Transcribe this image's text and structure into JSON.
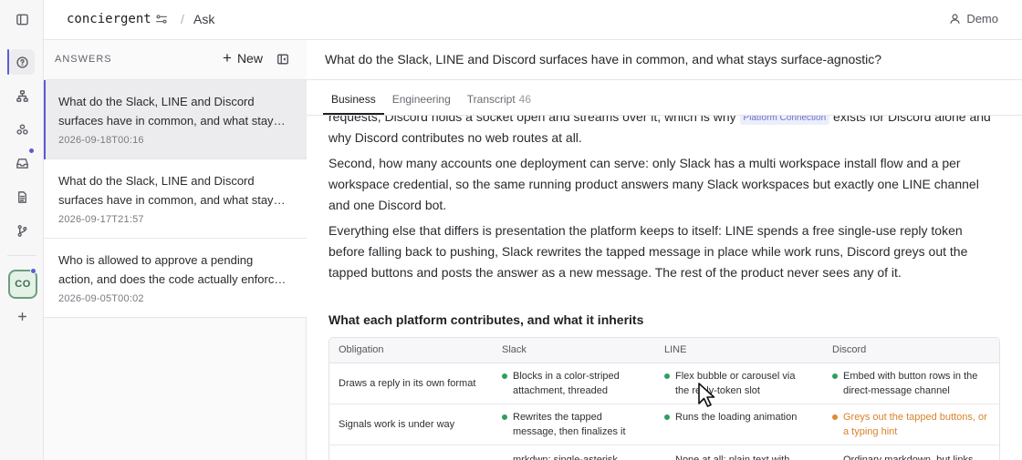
{
  "app": {
    "name": "conciergent",
    "breadcrumb": "Ask",
    "breadcrumb_separator": "/",
    "user": "Demo",
    "workspace_initials": "CO",
    "accent_color": "#5b5bd6"
  },
  "rail": {
    "icons": [
      "sidebar-toggle-icon",
      "chat-icon",
      "network-icon",
      "modules-icon",
      "inbox-icon",
      "document-icon",
      "branch-icon",
      "plus-icon"
    ]
  },
  "answers": {
    "title": "ANSWERS",
    "new_label": "New",
    "items": [
      {
        "question": "What do the Slack, LINE and Discord surfaces have in common, and what stays surface-agnostic?",
        "timestamp": "2026-09-18T00:16"
      },
      {
        "question": "What do the Slack, LINE and Discord surfaces have in common, and what stays surface-agnostic?",
        "timestamp": "2026-09-17T21:57"
      },
      {
        "question": "Who is allowed to approve a pending action, and does the code actually enforce it?",
        "timestamp": "2026-09-05T00:02"
      }
    ]
  },
  "main": {
    "question": "What do the Slack, LINE and Discord surfaces have in common, and what stays surface-agnostic?",
    "tabs": [
      {
        "label": "Business",
        "count": ""
      },
      {
        "label": "Engineering",
        "count": ""
      },
      {
        "label": "Transcript",
        "count": "46"
      }
    ],
    "para1_before": "requests, Discord holds a socket open and streams over it, which is why",
    "para1_tag": "Platform Connection",
    "para1_after": "exists for Discord alone and why Discord contributes no web routes at all.",
    "para2": "Second, how many accounts one deployment can serve: only Slack has a multi workspace install flow and a per workspace credential, so the same running product answers many Slack workspaces but exactly one LINE channel and one Discord bot.",
    "para3": "Everything else that differs is presentation the platform keeps to itself: LINE spends a free single-use reply token before falling back to pushing, Slack rewrites the tapped message in place while work runs, Discord greys out the tapped buttons and posts the answer as a new message. The rest of the product never sees any of it.",
    "section_title": "What each platform contributes, and what it inherits"
  },
  "table": {
    "headers": [
      "Obligation",
      "Slack",
      "LINE",
      "Discord"
    ],
    "rows": [
      {
        "obligation": "Draws a reply in its own format",
        "slack": "Blocks in a color-striped attachment, threaded",
        "line": "Flex bubble or carousel via the reply-token slot",
        "discord": "Embed with button rows in the direct-message channel"
      },
      {
        "obligation": "Signals work is under way",
        "slack": "Rewrites the tapped message, then finalizes it",
        "line": "Runs the loading animation",
        "discord": "Greys out the tapped buttons, or a typing hint"
      },
      {
        "obligation": "",
        "slack": "mrkdwn: single-asterisk",
        "line": "None at all; plain text with",
        "discord": "Ordinary markdown, but links"
      }
    ],
    "status_colors": {
      "ok": "#2f9e5a",
      "warn": "#e08a2e"
    }
  }
}
